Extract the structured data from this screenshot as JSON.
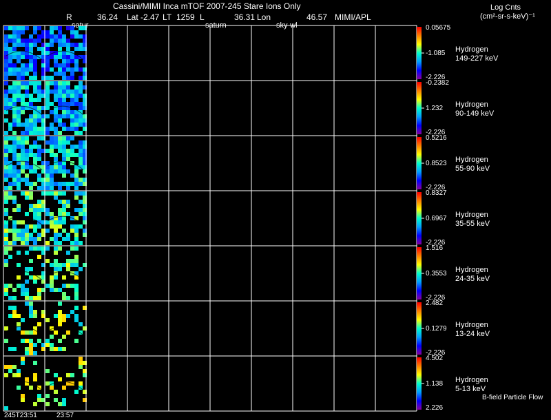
{
  "header": {
    "title": "Cassini/MIMI Inca mTOF  2007-245   Stare    Ions Only",
    "r_label": "R",
    "r_value": "36.24",
    "lat_label": "Lat",
    "lat_value": "-2.47",
    "lt_label": "LT",
    "lt_value": "1259",
    "l_label": "L",
    "l_value": "36.31",
    "lon_label": "Lon",
    "lon_value": "46.57",
    "credit": "MIMI/APL",
    "units_title": "Log Cnts",
    "units": "(cm²-sr-s-keV)⁻¹"
  },
  "overlay_labels": [
    "satur",
    "saturn",
    "sky-wl"
  ],
  "time_labels": [
    "245T23:51",
    "23:57"
  ],
  "footer_note": "B-field Particle Flow",
  "colors": {
    "background": "#000000",
    "grid": "#ffffff",
    "colorbar_stops": [
      "#8b00a0",
      "#0000ff",
      "#00a0ff",
      "#00ffcc",
      "#ffff00",
      "#ff8000",
      "#ff0000"
    ]
  },
  "chart_data": {
    "type": "heatmap",
    "title": "Cassini/MIMI Inca mTOF  2007-245   Stare    Ions Only",
    "columns": 10,
    "filled_columns": 2,
    "bands": [
      {
        "species": "Hydrogen",
        "energy": "149-227 keV",
        "max": "0.05675",
        "mid": "-1.085",
        "min": "-2.226",
        "fill": 0.75,
        "level": 0.3
      },
      {
        "species": "Hydrogen",
        "energy": "90-149 keV",
        "max": "-0.2382",
        "mid": "1.232",
        "min": "-2.226",
        "fill": 0.75,
        "level": 0.38
      },
      {
        "species": "Hydrogen",
        "energy": "55-90 keV",
        "max": "0.5216",
        "mid": "0.8523",
        "min": "-2.226",
        "fill": 0.72,
        "level": 0.42
      },
      {
        "species": "Hydrogen",
        "energy": "35-55 keV",
        "max": "0.8327",
        "mid": "0.6967",
        "min": "-2.226",
        "fill": 0.6,
        "level": 0.48
      },
      {
        "species": "Hydrogen",
        "energy": "24-35 keV",
        "max": "1.516",
        "mid": "0.3553",
        "min": "-2.226",
        "fill": 0.38,
        "level": 0.52
      },
      {
        "species": "Hydrogen",
        "energy": "13-24 keV",
        "max": "2.482",
        "mid": "0.1279",
        "min": "-2.226",
        "fill": 0.28,
        "level": 0.55
      },
      {
        "species": "Hydrogen",
        "energy": "5-13 keV",
        "max": "4.502",
        "mid": "1.138",
        "min": "2.226",
        "fill": 0.22,
        "level": 0.58
      }
    ]
  }
}
